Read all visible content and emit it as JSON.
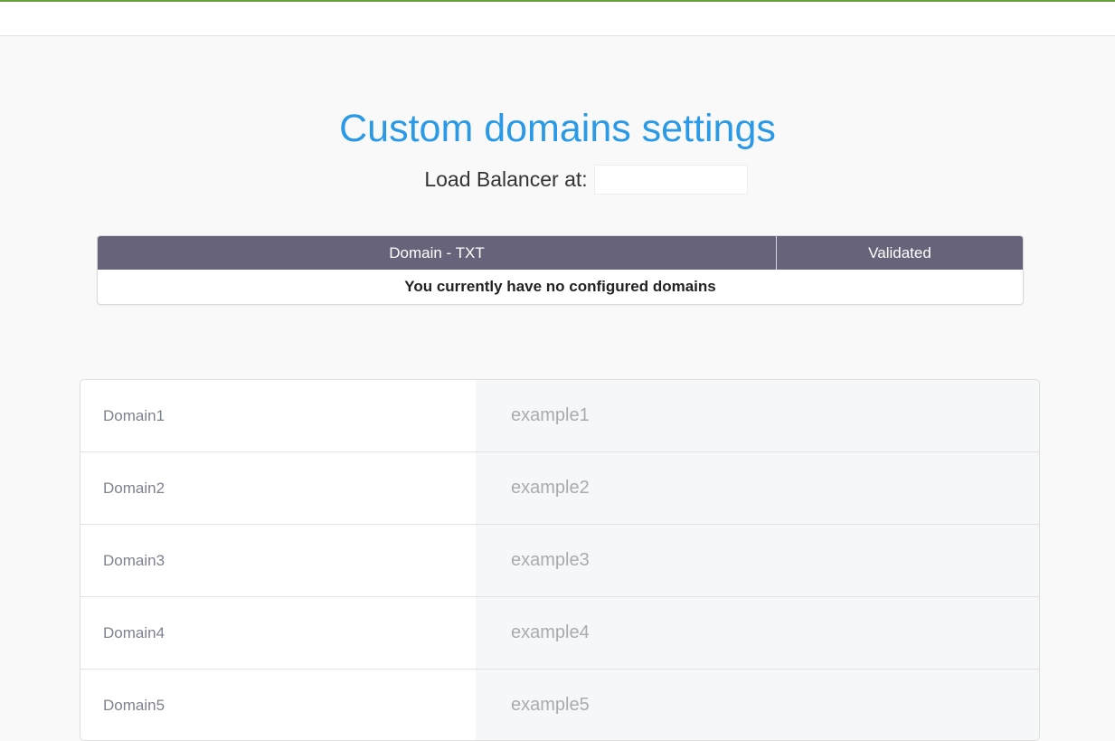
{
  "page": {
    "title": "Custom domains settings",
    "load_balancer_label": "Load Balancer at:",
    "load_balancer_value": ""
  },
  "domains_table": {
    "columns": [
      "Domain - TXT",
      "Validated"
    ],
    "empty_message": "You currently have no configured domains"
  },
  "domain_form": {
    "rows": [
      {
        "label": "Domain1",
        "placeholder": "example1",
        "value": ""
      },
      {
        "label": "Domain2",
        "placeholder": "example2",
        "value": ""
      },
      {
        "label": "Domain3",
        "placeholder": "example3",
        "value": ""
      },
      {
        "label": "Domain4",
        "placeholder": "example4",
        "value": ""
      },
      {
        "label": "Domain5",
        "placeholder": "example5",
        "value": ""
      }
    ]
  },
  "colors": {
    "accent_top_border": "#6aa13a",
    "title": "#2b9ae6",
    "table_header": "#67637a"
  }
}
